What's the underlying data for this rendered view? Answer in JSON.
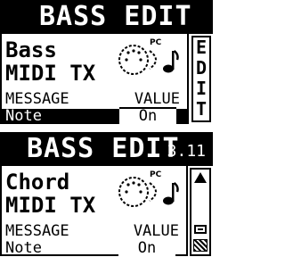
{
  "screen1": {
    "title": "BASS EDIT",
    "part_name": "Bass",
    "mode": "MIDI TX",
    "pc_label": "PC",
    "col_message": "MESSAGE",
    "col_value": "VALUE",
    "row": {
      "label": "Note",
      "value": "On"
    },
    "side_tab": [
      "E",
      "D",
      "I",
      "T"
    ]
  },
  "screen2": {
    "title": "BASS EDIT",
    "version": "3.11",
    "part_name": "Chord",
    "mode": "MIDI TX",
    "pc_label": "PC",
    "col_message": "MESSAGE",
    "col_value": "VALUE",
    "row": {
      "label": "Note",
      "value": "On"
    }
  }
}
